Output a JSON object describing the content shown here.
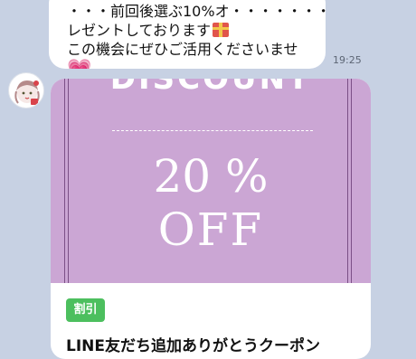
{
  "message": {
    "line1": "・・・前回後選ぶ10%オ・・・・・・・・",
    "line2": "レゼントしております",
    "line3": "この機会にぜひご活用くださいませ",
    "time": "19:25"
  },
  "icons": {
    "gift": "gift-icon",
    "heart": "heart-icon",
    "heart_glyph": "💗"
  },
  "coupon": {
    "header_text": "DISCOUNT",
    "percent_text": "20 %",
    "off_text": "OFF",
    "background_color": "#cba6d4",
    "badge_label": "割引",
    "badge_color": "#4cbf5e",
    "title": "LINE友だち追加ありがとうクーポン"
  }
}
